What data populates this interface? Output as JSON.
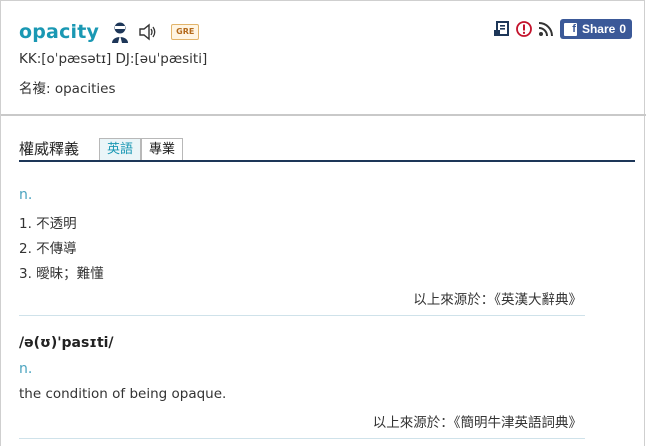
{
  "header": {
    "word": "opacity",
    "badge": "GRE",
    "kk_dj": "KK:[oˈpæsətɪ] DJ:[əuˈpæsiti]",
    "plural": "名複: opacities",
    "share": {
      "label": "Share",
      "count": "0"
    }
  },
  "tabs": {
    "section_title": "權威釋義",
    "items": [
      "英語",
      "專業"
    ],
    "active": "英語"
  },
  "entries": [
    {
      "pos": "n.",
      "definitions": [
        "1. 不透明",
        "2. 不傳導",
        "3. 曖昧；難懂"
      ],
      "source": "以上來源於：《英漢大辭典》"
    },
    {
      "ipa": "/ə(ʊ)'pasɪti/",
      "pos": "n.",
      "definitions": [
        "the condition of being opaque."
      ],
      "source": "以上來源於：《簡明牛津英語詞典》"
    }
  ],
  "colors": {
    "accent": "#1a98b3",
    "facebook": "#3b5998",
    "rule": "#1d3658"
  },
  "icons": [
    "person-icon",
    "speaker-icon",
    "note-icon",
    "alert-icon",
    "rss-icon",
    "facebook-icon"
  ]
}
